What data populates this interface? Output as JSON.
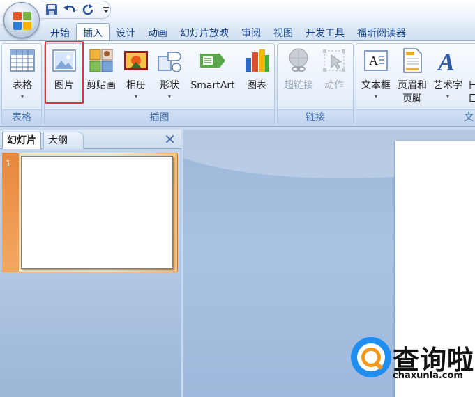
{
  "quick_access": {
    "icons": [
      "save-icon",
      "undo-icon",
      "redo-icon",
      "customize-quick-access-icon"
    ]
  },
  "tabs": [
    {
      "label": "开始"
    },
    {
      "label": "插入",
      "active": true
    },
    {
      "label": "设计"
    },
    {
      "label": "动画"
    },
    {
      "label": "幻灯片放映"
    },
    {
      "label": "审阅"
    },
    {
      "label": "视图"
    },
    {
      "label": "开发工具"
    },
    {
      "label": "福昕阅读器"
    }
  ],
  "ribbon": {
    "groups": {
      "tables": {
        "label": "表格",
        "buttons": {
          "table": "表格"
        }
      },
      "illustrations": {
        "label": "插图",
        "buttons": {
          "picture": "图片",
          "clipart": "剪贴画",
          "album": "相册",
          "shapes": "形状",
          "smartart": "SmartArt",
          "chart": "图表"
        }
      },
      "links": {
        "label": "链接",
        "buttons": {
          "hyperlink": "超链接",
          "action": "动作"
        }
      },
      "text": {
        "label": "文",
        "buttons": {
          "textbox": "文本框",
          "header_footer_1": "页眉和",
          "header_footer_2": "页脚",
          "wordart": "艺术字",
          "date_partial_1": "日",
          "date_partial_2": "日"
        }
      }
    },
    "highlighted_button": "图片"
  },
  "slides_pane": {
    "tabs": {
      "slides": "幻灯片",
      "outline": "大纲"
    },
    "close_glyph": "✕",
    "slides": [
      {
        "number": "1"
      }
    ]
  },
  "watermark": {
    "text": "查询啦",
    "url": "chaxunla.com"
  },
  "colors": {
    "highlight_border": "#d9363e",
    "accent_orange": "#f39a1e",
    "ribbon_text": "#15428b"
  }
}
